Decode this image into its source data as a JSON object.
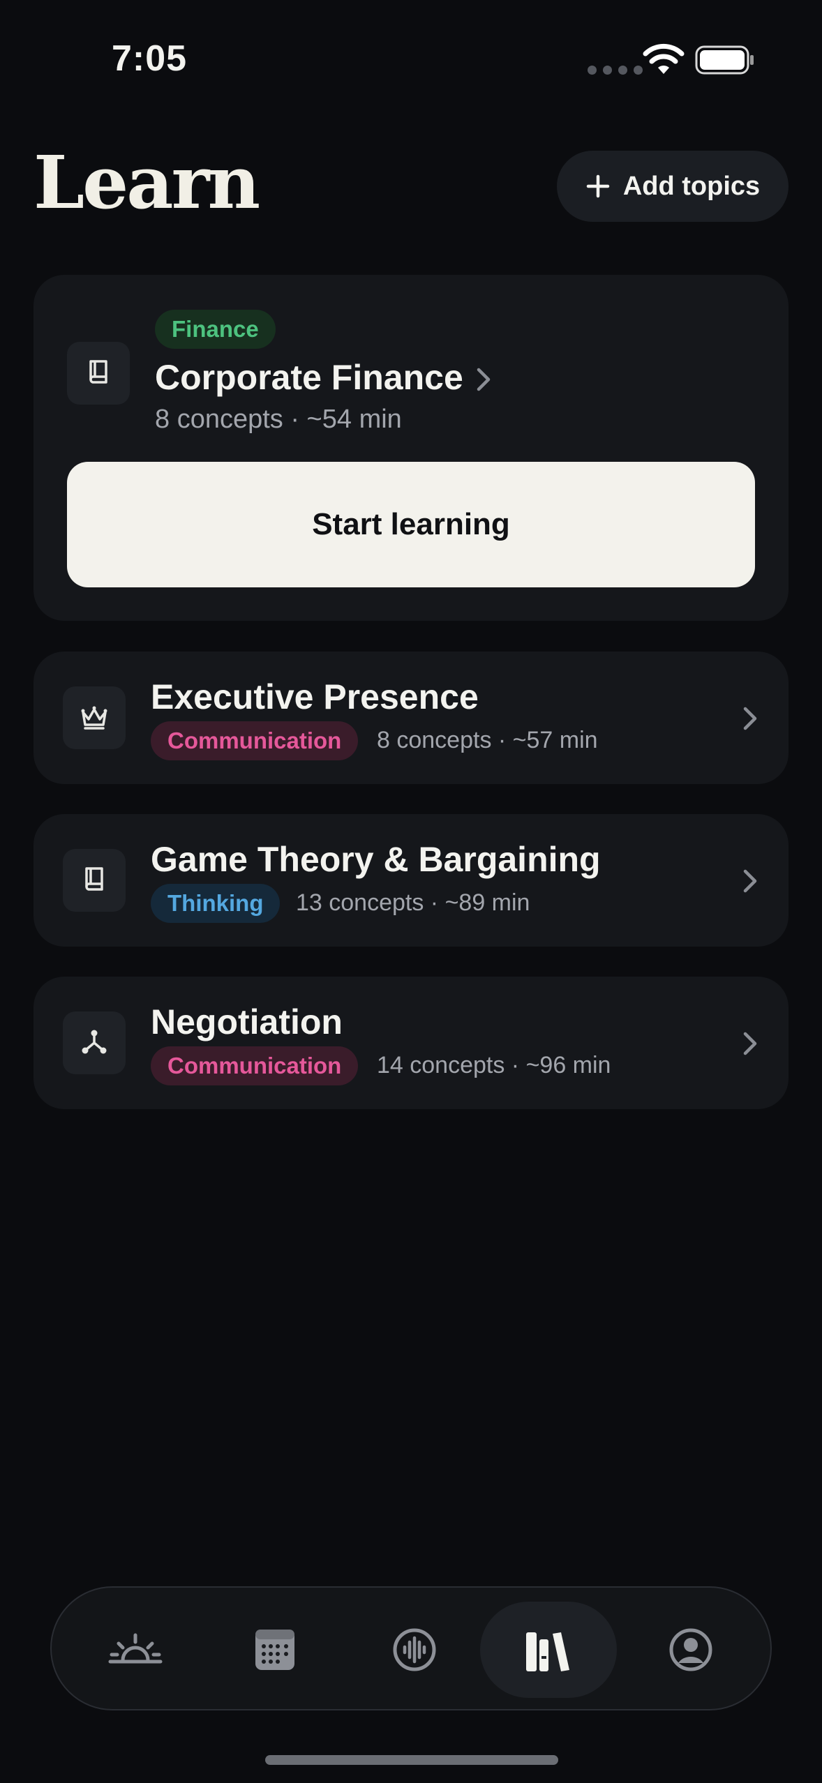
{
  "status": {
    "time": "7:05"
  },
  "header": {
    "title": "Learn",
    "add_topics_label": "Add topics"
  },
  "featured": {
    "tag": "Finance",
    "title": "Corporate Finance",
    "meta": "8 concepts · ~54 min",
    "icon": "book-icon",
    "cta_label": "Start learning"
  },
  "topics": [
    {
      "title": "Executive Presence",
      "tag": "Communication",
      "meta": "8 concepts · ~57 min",
      "icon": "crown-icon"
    },
    {
      "title": "Game Theory & Bargaining",
      "tag": "Thinking",
      "meta": "13 concepts · ~89 min",
      "icon": "book-icon"
    },
    {
      "title": "Negotiation",
      "tag": "Communication",
      "meta": "14 concepts · ~96 min",
      "icon": "network-icon"
    }
  ],
  "tab_bar": {
    "tabs": [
      {
        "name": "sunrise-icon",
        "active": false
      },
      {
        "name": "calendar-icon",
        "active": false
      },
      {
        "name": "audio-icon",
        "active": false
      },
      {
        "name": "library-icon",
        "active": true
      },
      {
        "name": "profile-icon",
        "active": false
      }
    ]
  },
  "colors": {
    "background": "#0b0c0f",
    "card": "#15171b",
    "finance_tag": "#4dc27f",
    "communication_tag": "#e5589a",
    "thinking_tag": "#54a8e0",
    "cta_background": "#f3f2ec"
  }
}
